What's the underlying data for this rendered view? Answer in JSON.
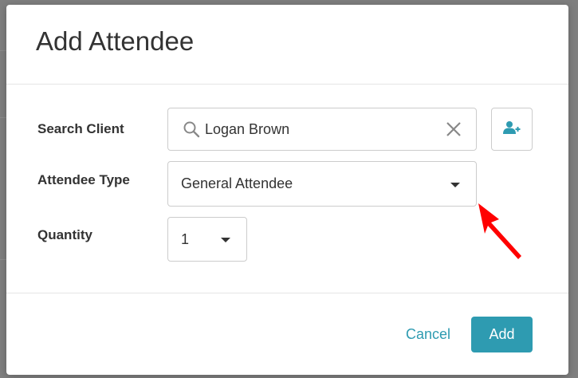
{
  "dialog": {
    "title": "Add Attendee"
  },
  "form": {
    "search_client": {
      "label": "Search Client",
      "value": "Logan Brown",
      "icon": "search-icon",
      "clear_icon": "close-icon",
      "add_icon": "add-user-icon"
    },
    "attendee_type": {
      "label": "Attendee Type",
      "selected": "General Attendee"
    },
    "quantity": {
      "label": "Quantity",
      "selected": "1"
    }
  },
  "footer": {
    "cancel_label": "Cancel",
    "add_label": "Add"
  },
  "colors": {
    "accent": "#2e9bb1",
    "annotation_arrow": "#ff0000"
  }
}
